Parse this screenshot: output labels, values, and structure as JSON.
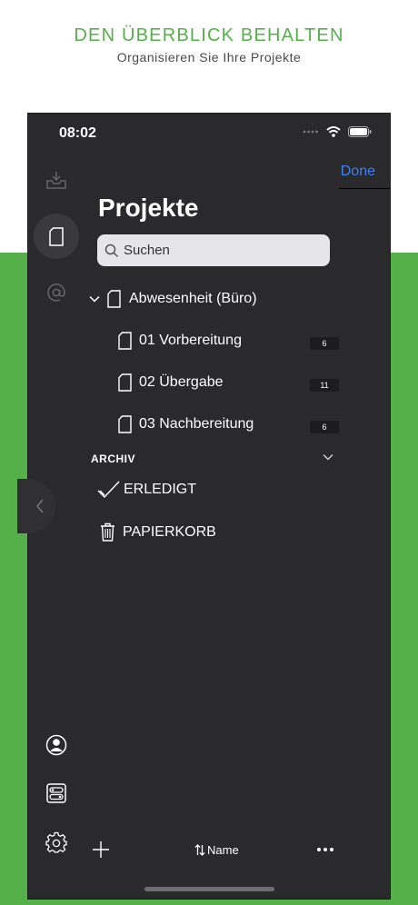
{
  "headline": "DEN ÜBERBLICK BEHALTEN",
  "subline": "Organisieren Sie Ihre Projekte",
  "status": {
    "time": "08:02"
  },
  "header": {
    "done_label": "Done",
    "title": "Projekte"
  },
  "search": {
    "placeholder": "Suchen"
  },
  "projects": {
    "group": {
      "label": "Abwesenheit (Büro)"
    },
    "items": [
      {
        "label": "01 Vorbereitung",
        "count": "6"
      },
      {
        "label": "02 Übergabe",
        "count": "11"
      },
      {
        "label": "03 Nachbereitung",
        "count": "6"
      }
    ]
  },
  "archive": {
    "title": "ARCHIV",
    "done_label": "ERLEDIGT",
    "trash_label": "PAPIERKORB"
  },
  "bottom": {
    "sort_label": "Name"
  },
  "colors": {
    "accent": "#55b04a",
    "link": "#3b82f6",
    "panel": "#2a2a2c"
  }
}
